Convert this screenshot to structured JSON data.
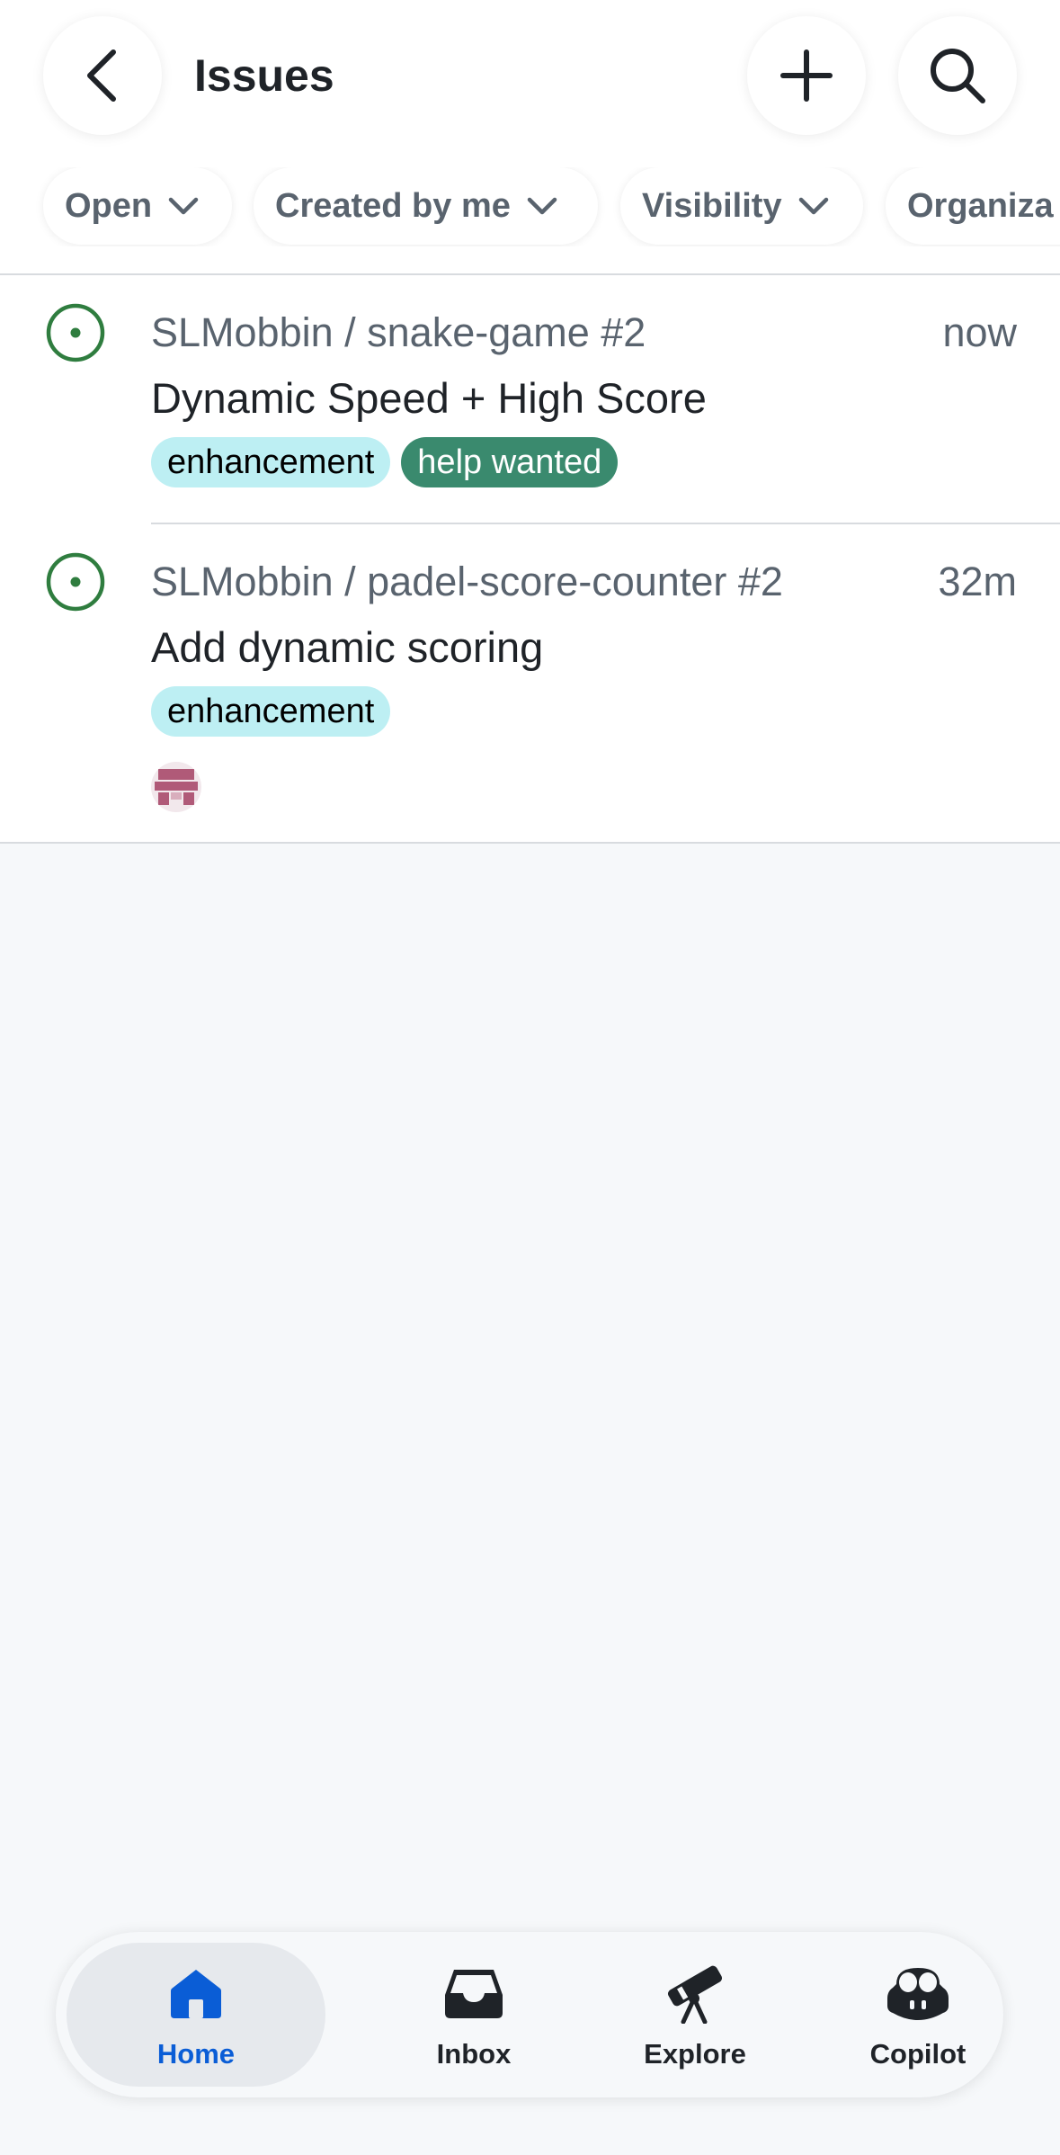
{
  "header": {
    "title": "Issues"
  },
  "filters": [
    {
      "label": "Open"
    },
    {
      "label": "Created by me"
    },
    {
      "label": "Visibility"
    },
    {
      "label": "Organiza"
    }
  ],
  "issues": [
    {
      "repo": "SLMobbin / snake-game #2",
      "time": "now",
      "title": "Dynamic Speed + High Score",
      "labels": [
        "enhancement",
        "help wanted"
      ],
      "status": "open"
    },
    {
      "repo": "SLMobbin / padel-score-counter #2",
      "time": "32m",
      "title": "Add dynamic scoring",
      "labels": [
        "enhancement"
      ],
      "status": "open"
    }
  ],
  "tabbar": {
    "tabs": [
      {
        "label": "Home",
        "icon": "home-icon",
        "active": true
      },
      {
        "label": "Inbox",
        "icon": "inbox-icon"
      },
      {
        "label": "Explore",
        "icon": "telescope-icon"
      },
      {
        "label": "Copilot",
        "icon": "copilot-icon"
      }
    ]
  },
  "colors": {
    "open_status": "#2f7d3f",
    "active_tab": "#0a5dd6",
    "label_enhancement": "#bdeff3",
    "label_help_wanted": "#3a8a6e"
  }
}
